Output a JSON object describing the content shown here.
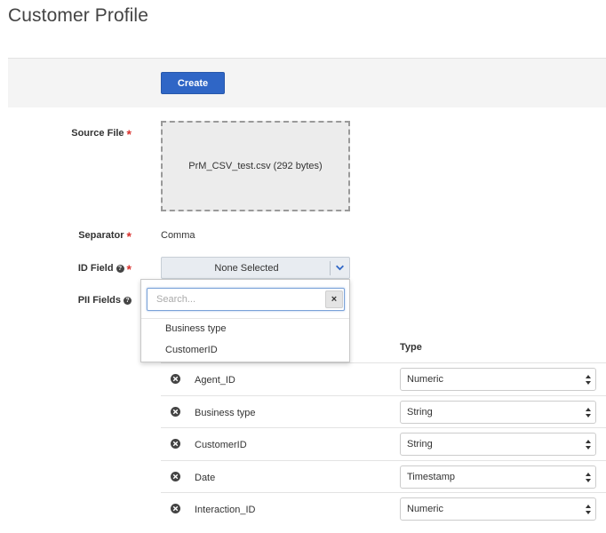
{
  "page": {
    "title": "Customer Profile"
  },
  "toolbar": {
    "create_label": "Create"
  },
  "form": {
    "source_file": {
      "label": "Source File",
      "value": "PrM_CSV_test.csv (292 bytes)"
    },
    "separator": {
      "label": "Separator",
      "value": "Comma"
    },
    "id_field": {
      "label": "ID Field",
      "value": "None Selected"
    },
    "pii_fields": {
      "label": "PII Fields"
    }
  },
  "dropdown": {
    "search_placeholder": "Search...",
    "clear_label": "×",
    "options": [
      "Business type",
      "CustomerID"
    ]
  },
  "columns_table": {
    "type_header": "Type",
    "rows": [
      {
        "name": "Agent_ID",
        "type": "Numeric"
      },
      {
        "name": "Business type",
        "type": "String"
      },
      {
        "name": "CustomerID",
        "type": "String"
      },
      {
        "name": "Date",
        "type": "Timestamp"
      },
      {
        "name": "Interaction_ID",
        "type": "Numeric"
      }
    ]
  },
  "colors": {
    "accent": "#2f66c6",
    "required": "#d9322e"
  },
  "icons": {
    "help": "question-circle-icon",
    "remove": "times-circle-icon",
    "chevron": "chevron-down-icon"
  }
}
